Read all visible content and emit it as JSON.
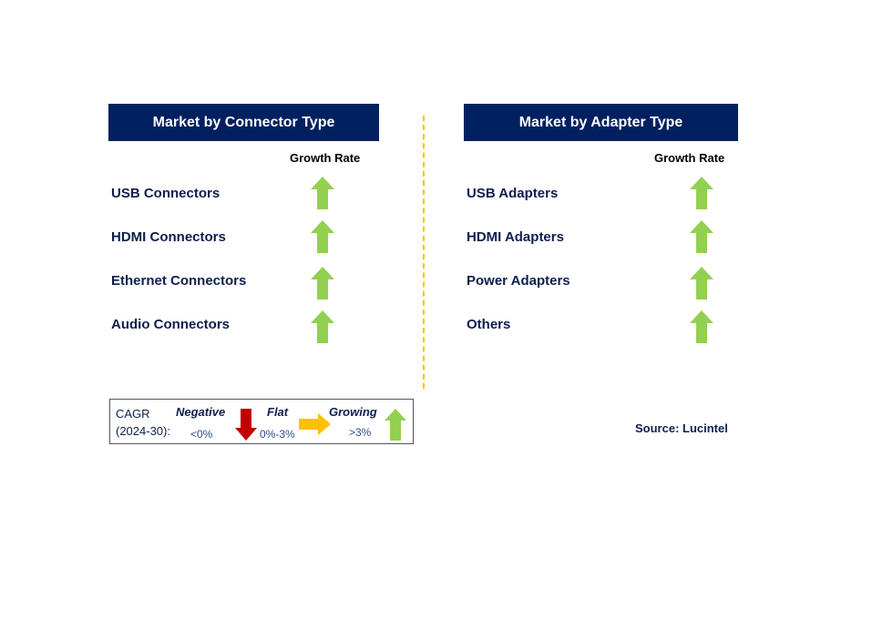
{
  "left": {
    "title": "Market by Connector Type",
    "growth_label": "Growth Rate",
    "items": [
      {
        "label": "USB Connectors",
        "trend": "growing"
      },
      {
        "label": "HDMI Connectors",
        "trend": "growing"
      },
      {
        "label": "Ethernet Connectors",
        "trend": "growing"
      },
      {
        "label": "Audio Connectors",
        "trend": "growing"
      }
    ]
  },
  "right": {
    "title": "Market by Adapter Type",
    "growth_label": "Growth Rate",
    "items": [
      {
        "label": "USB Adapters",
        "trend": "growing"
      },
      {
        "label": "HDMI Adapters",
        "trend": "growing"
      },
      {
        "label": "Power Adapters",
        "trend": "growing"
      },
      {
        "label": "Others",
        "trend": "growing"
      }
    ]
  },
  "legend": {
    "cagr": "CAGR",
    "period": "(2024-30):",
    "negative": "Negative",
    "negative_range": "<0%",
    "flat": "Flat",
    "flat_range": "0%-3%",
    "growing": "Growing",
    "growing_range": ">3%"
  },
  "source": "Source: Lucintel",
  "colors": {
    "header": "#002060",
    "growing": "#92d050",
    "negative": "#c00000",
    "flat": "#ffc000"
  }
}
